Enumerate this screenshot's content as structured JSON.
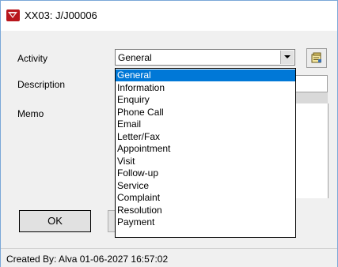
{
  "window": {
    "title": "XX03: J/J00006",
    "app_icon": "app-logo-icon"
  },
  "form": {
    "activity_label": "Activity",
    "description_label": "Description",
    "memo_label": "Memo",
    "activity_value": "General",
    "tool_button_icon": "notes-edit-icon"
  },
  "dropdown": {
    "selected": "General",
    "options": [
      "General",
      "Information",
      "Enquiry",
      "Phone Call",
      "Email",
      "Letter/Fax",
      "Appointment",
      "Visit",
      "Follow-up",
      "Service",
      "Complaint",
      "Resolution",
      "Payment"
    ]
  },
  "buttons": {
    "ok_label": "OK"
  },
  "status": {
    "text": "Created By: Alva 01-06-2027 16:57:02"
  },
  "colors": {
    "selection": "#0078d7",
    "accent_border": "#7aa7d8"
  }
}
